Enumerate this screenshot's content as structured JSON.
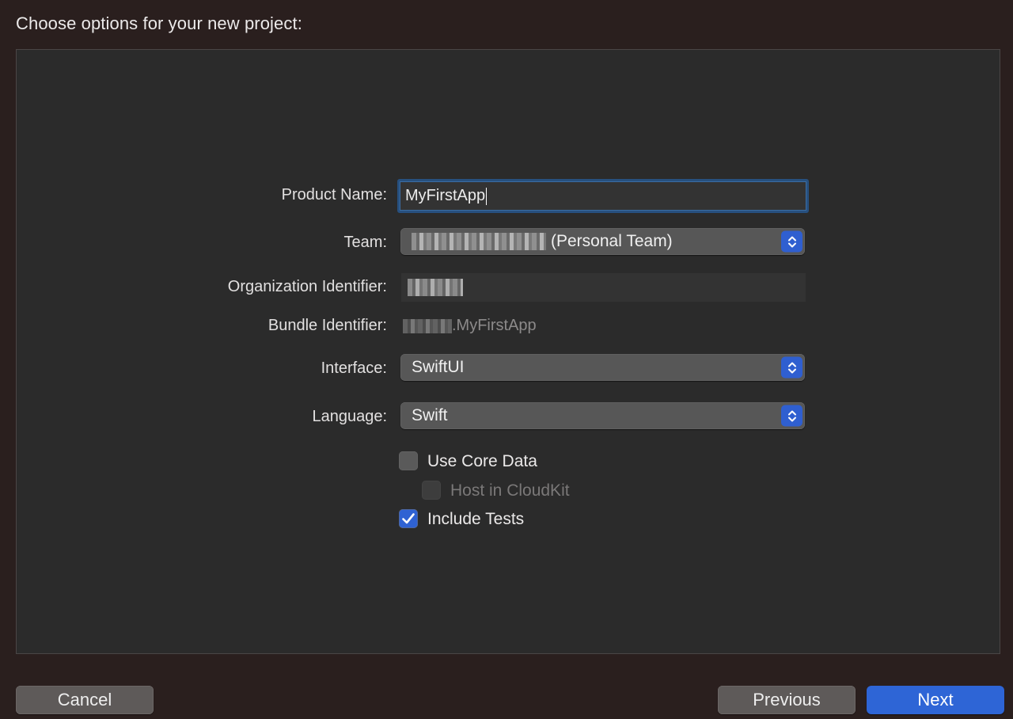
{
  "dialog": {
    "title": "Choose options for your new project:"
  },
  "form": {
    "product_name": {
      "label": "Product Name:",
      "value": "MyFirstApp"
    },
    "team": {
      "label": "Team:",
      "value_suffix": "(Personal Team)"
    },
    "organization_identifier": {
      "label": "Organization Identifier:"
    },
    "bundle_identifier": {
      "label": "Bundle Identifier:",
      "value_suffix": ".MyFirstApp"
    },
    "interface": {
      "label": "Interface:",
      "value": "SwiftUI"
    },
    "language": {
      "label": "Language:",
      "value": "Swift"
    },
    "use_core_data": {
      "label": "Use Core Data",
      "checked": false
    },
    "host_in_cloudkit": {
      "label": "Host in CloudKit",
      "checked": false,
      "enabled": false
    },
    "include_tests": {
      "label": "Include Tests",
      "checked": true
    }
  },
  "buttons": {
    "cancel": "Cancel",
    "previous": "Previous",
    "next": "Next"
  },
  "colors": {
    "accent": "#2e65d6",
    "focus_ring": "#27507f",
    "background": "#2a1f1e",
    "panel": "#2b2b2b"
  }
}
